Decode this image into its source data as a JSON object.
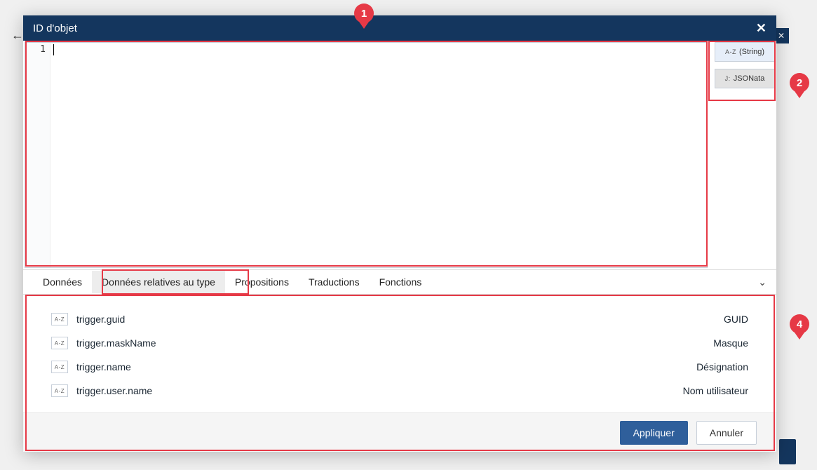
{
  "annotations": {
    "a1": "1",
    "a2": "2",
    "a4": "4"
  },
  "dialog": {
    "title": "ID d'objet",
    "close_glyph": "✕"
  },
  "editor": {
    "gutter_line": "1",
    "content": ""
  },
  "type_buttons": {
    "string": {
      "prefix": "A-Z",
      "label": "(String)"
    },
    "jsonata": {
      "prefix": "J:",
      "label": "JSONata"
    }
  },
  "tabs": {
    "t0": "Données",
    "t1": "Données relatives au type",
    "t2": "Propositions",
    "t3": "Traductions",
    "t4": "Fonctions"
  },
  "rows": [
    {
      "badge": "A-Z",
      "path": "trigger.guid",
      "desc": "GUID"
    },
    {
      "badge": "A-Z",
      "path": "trigger.maskName",
      "desc": "Masque"
    },
    {
      "badge": "A-Z",
      "path": "trigger.name",
      "desc": "Désignation"
    },
    {
      "badge": "A-Z",
      "path": "trigger.user.name",
      "desc": "Nom utilisateur"
    }
  ],
  "footer": {
    "apply": "Appliquer",
    "cancel": "Annuler"
  }
}
